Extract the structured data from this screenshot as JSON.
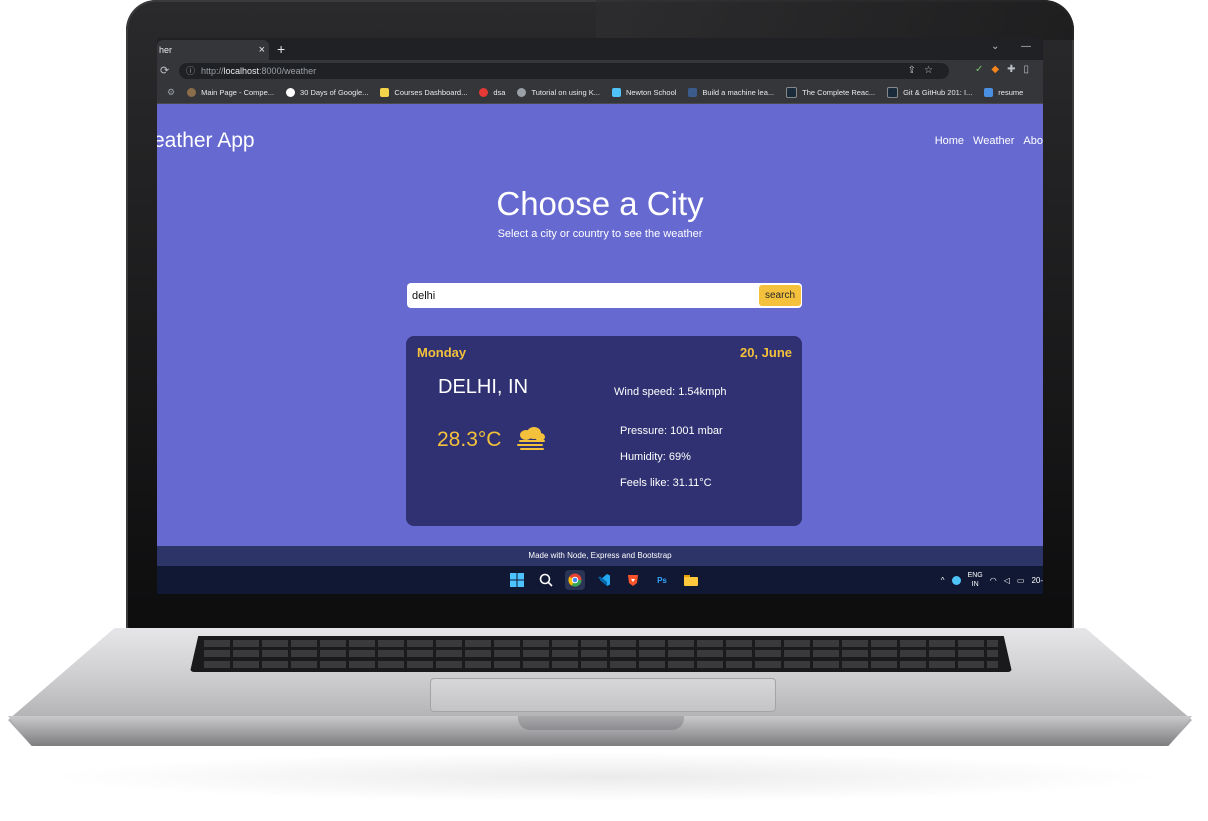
{
  "browser": {
    "tab_title": "her",
    "tab_close": "×",
    "new_tab": "+",
    "window_min": "—",
    "window_menu": "⌄",
    "url_prefix": "http://",
    "url_host": "localhost",
    "url_rest": ":8000/weather",
    "bookmarks": [
      {
        "label": "Main Page - Compe...",
        "color": "#8a6d4a"
      },
      {
        "label": "30 Days of Google...",
        "color": "#ffffff"
      },
      {
        "label": "Courses Dashboard...",
        "color": "#f3d54b"
      },
      {
        "label": "dsa",
        "color": "#e53935"
      },
      {
        "label": "Tutorial on using K...",
        "color": "#9aa0a6"
      },
      {
        "label": "Newton School",
        "color": "#4fc3f7"
      },
      {
        "label": "Build a machine lea...",
        "color": "#3b5b8a"
      },
      {
        "label": "The Complete Reac...",
        "color": "#1a2b3c"
      },
      {
        "label": "Git & GitHub 201: I...",
        "color": "#1a2b3c"
      },
      {
        "label": "resume",
        "color": "#4a90e2"
      }
    ]
  },
  "app": {
    "brand": "eather App",
    "nav": [
      "Home",
      "Weather",
      "Abo"
    ]
  },
  "hero": {
    "title": "Choose a City",
    "subtitle": "Select a city or country to see the weather"
  },
  "search": {
    "value": "delhi",
    "button": "search"
  },
  "weather": {
    "day": "Monday",
    "date": "20, June",
    "city": "DELHI, IN",
    "temp": "28.3°C",
    "condition_icon": "fog-icon",
    "wind": "Wind speed: 1.54kmph",
    "pressure": "Pressure: 1001 mbar",
    "humidity": "Humidity: 69%",
    "feels_like": "Feels like: 31.11°C"
  },
  "footer": {
    "text": "Made with Node, Express and Bootstrap"
  },
  "taskbar": {
    "lang_line1": "ENG",
    "lang_line2": "IN",
    "clock": "20-"
  },
  "colors": {
    "page_bg": "#6669d0",
    "card_bg": "#303172",
    "accent": "#f3c13b",
    "footer_bg": "#2d3468"
  }
}
